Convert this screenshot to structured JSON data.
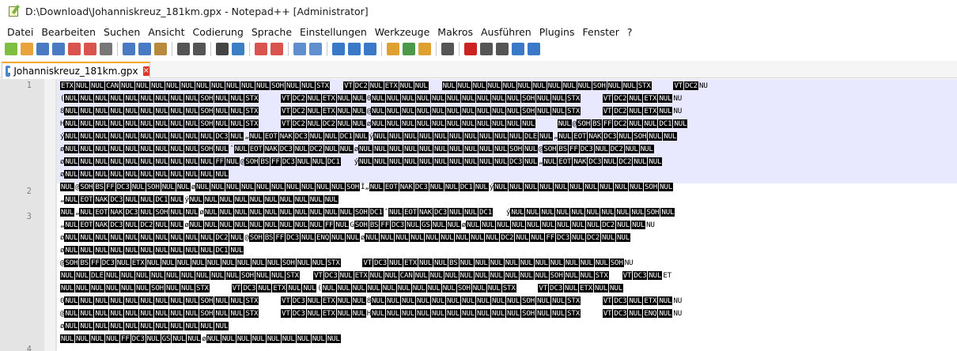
{
  "window": {
    "title": "D:\\Download\\Johanniskreuz_181km.gpx - Notepad++ [Administrator]"
  },
  "menu": [
    "Datei",
    "Bearbeiten",
    "Suchen",
    "Ansicht",
    "Codierung",
    "Sprache",
    "Einstellungen",
    "Werkzeuge",
    "Makros",
    "Ausführen",
    "Plugins",
    "Fenster",
    "?"
  ],
  "toolbar_icons": [
    {
      "name": "new-file-icon",
      "color": "#7fbf3f"
    },
    {
      "name": "open-file-icon",
      "color": "#e8a33a"
    },
    {
      "name": "save-icon",
      "color": "#4a7bc2"
    },
    {
      "name": "save-all-icon",
      "color": "#4a7bc2"
    },
    {
      "name": "close-icon",
      "color": "#d9534f"
    },
    {
      "name": "close-all-icon",
      "color": "#d9534f"
    },
    {
      "name": "print-icon",
      "color": "#777777"
    },
    {
      "name": "cut-icon",
      "color": "#4a7bc2"
    },
    {
      "name": "copy-icon",
      "color": "#4a7bc2"
    },
    {
      "name": "paste-icon",
      "color": "#b88a3e"
    },
    {
      "name": "undo-icon",
      "color": "#555555"
    },
    {
      "name": "redo-icon",
      "color": "#555555"
    },
    {
      "name": "find-icon",
      "color": "#444444"
    },
    {
      "name": "replace-icon",
      "color": "#3d7fc4"
    },
    {
      "name": "zoom-in-icon",
      "color": "#d9534f"
    },
    {
      "name": "zoom-out-icon",
      "color": "#d9534f"
    },
    {
      "name": "sync-vertical-icon",
      "color": "#5f8fcf"
    },
    {
      "name": "sync-horizontal-icon",
      "color": "#5f8fcf"
    },
    {
      "name": "word-wrap-icon",
      "color": "#3a78c8"
    },
    {
      "name": "show-all-chars-icon",
      "color": "#3a78c8"
    },
    {
      "name": "indent-guide-icon",
      "color": "#3a78c8"
    },
    {
      "name": "doc-map-icon",
      "color": "#e0a030"
    },
    {
      "name": "function-list-icon",
      "color": "#4a9a4a"
    },
    {
      "name": "folder-workspace-icon",
      "color": "#e0a030"
    },
    {
      "name": "monitoring-icon",
      "color": "#555555"
    },
    {
      "name": "record-macro-icon",
      "color": "#cc2222"
    },
    {
      "name": "stop-macro-icon",
      "color": "#555555"
    },
    {
      "name": "play-macro-icon",
      "color": "#555555"
    },
    {
      "name": "run-macro-multiple-icon",
      "color": "#3a78c8"
    },
    {
      "name": "save-macro-icon",
      "color": "#3a78c8"
    }
  ],
  "tab": {
    "label": "Johanniskreuz_181km.gpx",
    "close_symbol": "×"
  },
  "line_numbers": [
    "1",
    "2",
    "3",
    "4"
  ],
  "lines": [
    "ETX NUL NUL CAN NUL NUL NUL NUL NUL NUL NUL NUL NUL NUL SOH NUL NUL STX   VT DC2 NUL ETX NUL NUL   NUL NUL NUL NUL NUL NUL NUL NUL NUL NUL SOH NUL NUL STX     VT DC2 NU",
    "( NUL NUL NUL NUL NUL NUL NUL NUL NUL SOH NUL NUL STX     VT DC2 NUL ETX NUL NUL 0 NUL NUL NUL NUL NUL NUL NUL NUL NUL NUL SOH NUL NUL STX     VT DC2 NUL ETX NUL NU",
    "8 NUL NUL NUL NUL NUL NUL NUL NUL NUL SOH NUL NUL STX     VT DC2 NUL ETX NUL NUL @ NUL NUL NUL NUL NUL NUL NUL NUL NUL NUL SOH NUL NUL STX     VT DC2 NUL ETX NUL NU",
    "H NUL NUL NUL NUL NUL NUL NUL NUL NUL SOH NUL NUL STX     VT DC2 NUL DC2 NUL NUL ø NUL NUL NUL NUL NUL NUL NUL NUL NUL NUL NUL     NUL @ SOH BS FF DC2 NUL NUL DC1 NUL",
    "ý NUL NUL NUL NUL NUL NUL NUL NUL NUL NUL DC3 NUL „ NUL EOT NAK DC3 NUL NUL DC1 NUL ý NUL NUL NUL NUL NUL NUL NUL NUL NUL NUL DLE NUL „ NUL EOT NAK DC3 NUL SOH NUL NUL",
    "ø NUL NUL NUL NUL NUL NUL NUL NUL NUL SOH NUL ˆ NUL EOT NAK DC3 NUL DC2 NUL NUL ø NUL NUL NUL NUL NUL NUL NUL NUL NUL NUL SOH NUL @ SOH BS FF DC3 NUL DC2 NUL NUL",
    "ø NUL NUL NUL NUL NUL NUL NUL NUL NUL NUL FF NUL @ SOH BS FF DC3 NUL NUL DC1   ý NUL NUL NUL NUL NUL NUL NUL NUL NUL NUL DC3 NUL „ NUL EOT NAK DC3 NUL DC2 NUL NUL",
    "ø NUL NUL NUL NUL NUL NUL NUL NUL NUL NUL NUL",
    "NUL @ SOH BS FF DC3 NUL SOH NUL NUL ø NUL NUL NUL NUL NUL NUL NUL NUL NUL NUL SOH Ì „ NUL EOT NAK DC3 NUL NUL DC1 NUL ý NUL NUL NUL NUL NUL NUL NUL NUL NUL NUL SOH NUL",
    "„ NUL EOT NAK DC3 NUL NUL DC1 NUL ý NUL NUL NUL NUL NUL NUL NUL NUL NUL NUL",
    "NUL „ NUL EOT NAK DC3 NUL SOH NUL NUL ø NUL NUL NUL NUL NUL NUL NUL NUL NUL NUL SOH DC1 ˆ NUL EOT NAK DC3 NUL NUL DC1   ý NUL NUL NUL NUL NUL NUL NUL NUL NUL SOH NUL",
    "„ NUL EOT NAK DC3 NUL DC2 NUL NUL ø NUL NUL NUL NUL NUL NUL NUL NUL NUL FF NUL G SOH BS FF DC3 NUL GS NUL NUL ø NUL NUL NUL NUL NUL NUL NUL NUL NUL DC2 NUL NUL NU",
    "ø NUL NUL NUL NUL NUL NUL NUL NUL NUL NUL DC2 NUL @ SOH BS FF DC3 NUL ENQ NUL NUL ø NUL NUL NUL NUL NUL NUL NUL NUL NUL DC2 NUL NUL FF DC3 NUL DC2 NUL NUL",
    "ø NUL NUL NUL NUL NUL NUL NUL NUL NUL NUL DC1 NUL",
    "@ SOH BS FF DC3 NUL ETX NUL NUL NUL NUL NUL NUL NUL NUL NUL SOH NUL NUL STX     VT DC3 NUL ETX NUL NUL BS NUL NUL NUL NUL NUL NUL NUL NUL NUL NUL SOH NU",
    "NUL NUL DLE NUL NUL NUL NUL NUL NUL NUL NUL NUL SOH NUL NUL STX   VT DC3 NUL ETX NUL NUL CAN NUL NUL NUL NUL NUL NUL NUL NUL NUL SOH NUL NUL STX   VT DC3 NUL ET",
    "NUL NUL NUL NUL NUL NUL SOH NUL NUL STX     VT DC3 NUL ETX NUL NUL ( NUL NUL NUL NUL NUL NUL NUL NUL NUL SOH NUL NUL STX     VT DC3 NUL ETX NUL NUL",
    "0 NUL NUL NUL NUL NUL NUL NUL NUL NUL SOH NUL NUL STX     VT DC3 NUL ETX NUL NUL 8 NUL NUL NUL NUL NUL NUL NUL NUL NUL NUL SOH NUL NUL STX     VT DC3 NUL ETX NUL NU",
    "@ NUL NUL NUL NUL NUL NUL NUL NUL NUL SOH NUL NUL STX     VT DC3 NUL ETX NUL NUL H NUL NUL NUL NUL NUL NUL NUL NUL NUL NUL SOH NUL NUL STX     VT DC3 NUL ENQ NUL NU",
    "ø NUL NUL NUL NUL NUL NUL NUL NUL NUL NUL NUL",
    "NUL NUL NUL NUL FF DC3 NUL GS NUL NUL ø NUL NUL NUL NUL NUL NUL NUL NUL NUL"
  ]
}
